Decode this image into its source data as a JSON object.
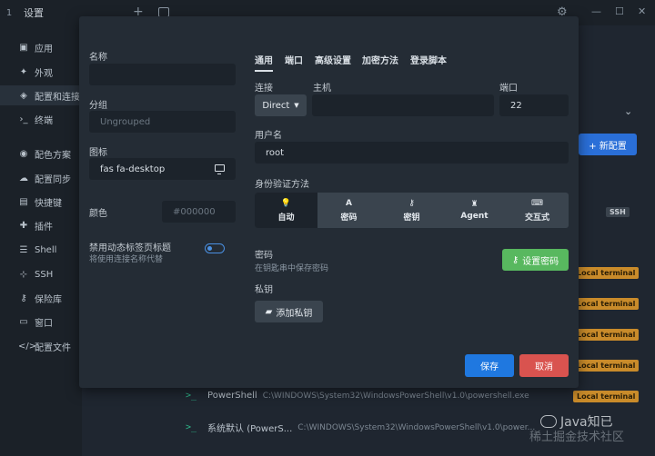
{
  "window": {
    "tab_number": "1",
    "title": "设置"
  },
  "sidebar": {
    "items": [
      {
        "label": "应用",
        "icon": "app-icon"
      },
      {
        "label": "外观",
        "icon": "appearance-icon"
      },
      {
        "label": "配置和连接",
        "icon": "profiles-icon"
      },
      {
        "label": "终端",
        "icon": "terminal-icon"
      },
      {
        "label": "配色方案",
        "icon": "palette-icon"
      },
      {
        "label": "配置同步",
        "icon": "cloud-icon"
      },
      {
        "label": "快捷键",
        "icon": "keyboard-icon"
      },
      {
        "label": "插件",
        "icon": "plugin-icon"
      },
      {
        "label": "Shell",
        "icon": "list-icon"
      },
      {
        "label": "SSH",
        "icon": "network-icon"
      },
      {
        "label": "保险库",
        "icon": "key-icon"
      },
      {
        "label": "窗口",
        "icon": "window-icon"
      },
      {
        "label": "配置文件",
        "icon": "code-icon"
      }
    ]
  },
  "background": {
    "new_profile_label": "+ 新配置",
    "ssh_tag": "SSH",
    "badge": "Local terminal",
    "rows": [
      {
        "name": "PowerShell",
        "path": "C:\\WINDOWS\\System32\\WindowsPowerShell\\v1.0\\powershell.exe"
      },
      {
        "name": "系统默认 (PowerS...",
        "path": "C:\\WINDOWS\\System32\\WindowsPowerShell\\v1.0\\power..."
      }
    ]
  },
  "modal": {
    "left": {
      "name_label": "名称",
      "name_value": "",
      "group_label": "分组",
      "group_placeholder": "Ungrouped",
      "icon_label": "图标",
      "icon_value": "fas fa-desktop",
      "color_label": "颜色",
      "color_placeholder": "#000000",
      "disable_title_label": "禁用动态标签页标题",
      "disable_title_sub": "将使用连接名称代替"
    },
    "tabs": [
      "通用",
      "端口",
      "高级设置",
      "加密方法",
      "登录脚本"
    ],
    "connection_label": "连接",
    "connection_value": "Direct",
    "host_label": "主机",
    "host_value": "",
    "port_label": "端口",
    "port_value": "22",
    "username_label": "用户名",
    "username_value": "root",
    "auth_label": "身份验证方法",
    "auth_options": [
      {
        "label": "自动",
        "icon": "bulb-icon"
      },
      {
        "label": "密码",
        "icon": "font-icon"
      },
      {
        "label": "密钥",
        "icon": "key-icon"
      },
      {
        "label": "Agent",
        "icon": "agent-icon"
      },
      {
        "label": "交互式",
        "icon": "keyboard-icon"
      }
    ],
    "password_label": "密码",
    "password_sub": "在钥匙串中保存密码",
    "set_password_label": "设置密码",
    "private_key_label": "私钥",
    "add_key_label": "添加私钥",
    "save_label": "保存",
    "cancel_label": "取消"
  },
  "watermark": {
    "text": "Java知已",
    "sub": "稀土掘金技术社区"
  }
}
